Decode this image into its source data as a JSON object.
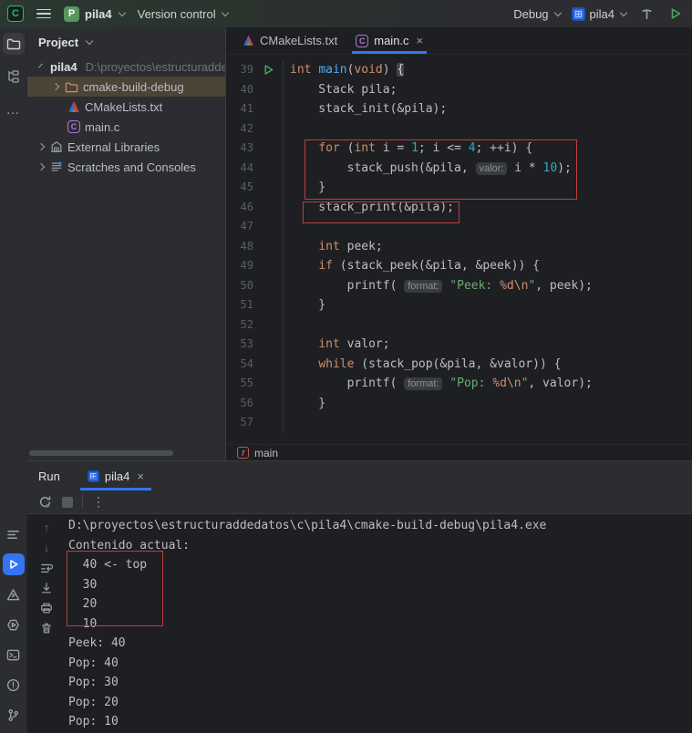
{
  "appearance": {
    "accent_blue": "#3574F0",
    "annotation_red": "#C43B3B",
    "keyword_orange": "#CF8E6D",
    "number_teal": "#2AACB8",
    "string_green": "#6AAB73",
    "run_green": "#4FA45F",
    "selected_row_brown": "#4B4336",
    "editor_bg": "#1E1F22",
    "panel_bg": "#2B2D30"
  },
  "icons": {
    "hamburger": "menu",
    "more_horizontal": "...",
    "more_vertical": "⋮",
    "close": "×",
    "arrow_up": "↑",
    "arrow_down": "↓"
  },
  "titlebar": {
    "project_name": "pila4",
    "version_control_label": "Version control",
    "debug_label": "Debug",
    "run_config_label": "pila4"
  },
  "project_panel": {
    "title": "Project",
    "items": [
      {
        "label": "pila4",
        "path": "D:\\proyectos\\estructuradded",
        "type": "project-root"
      },
      {
        "label": "cmake-build-debug",
        "type": "excluded-folder",
        "selected": true
      },
      {
        "label": "CMakeLists.txt",
        "type": "cmake-file"
      },
      {
        "label": "main.c",
        "type": "c-file"
      },
      {
        "label": "External Libraries",
        "type": "libraries"
      },
      {
        "label": "Scratches and Consoles",
        "type": "scratches"
      }
    ]
  },
  "editor": {
    "tabs": [
      {
        "label": "CMakeLists.txt",
        "active": false
      },
      {
        "label": "main.c",
        "active": true
      }
    ],
    "breadcrumb": "main",
    "lines": [
      {
        "num": 39,
        "gutter": "run",
        "tokens": [
          {
            "c": "k",
            "t": "int "
          },
          {
            "c": "f",
            "t": "main"
          },
          {
            "c": "d",
            "t": "("
          },
          {
            "c": "k",
            "t": "void"
          },
          {
            "c": "d",
            "t": ") "
          },
          {
            "c": "b",
            "t": "{"
          }
        ]
      },
      {
        "num": 40,
        "tokens": [
          {
            "c": "d",
            "t": "    Stack pila;"
          }
        ]
      },
      {
        "num": 41,
        "tokens": [
          {
            "c": "d",
            "t": "    stack_init(&pila);"
          }
        ]
      },
      {
        "num": 42,
        "tokens": []
      },
      {
        "num": 43,
        "tokens": [
          {
            "c": "d",
            "t": "    "
          },
          {
            "c": "k",
            "t": "for"
          },
          {
            "c": "d",
            "t": " ("
          },
          {
            "c": "k",
            "t": "int"
          },
          {
            "c": "d",
            "t": " i = "
          },
          {
            "c": "n",
            "t": "1"
          },
          {
            "c": "d",
            "t": "; i <= "
          },
          {
            "c": "n",
            "t": "4"
          },
          {
            "c": "d",
            "t": "; ++i) {"
          }
        ]
      },
      {
        "num": 44,
        "tokens": [
          {
            "c": "d",
            "t": "        stack_push(&pila, "
          },
          {
            "c": "h",
            "t": "valor:"
          },
          {
            "c": "d",
            "t": " i * "
          },
          {
            "c": "n",
            "t": "10"
          },
          {
            "c": "d",
            "t": ");"
          }
        ]
      },
      {
        "num": 45,
        "tokens": [
          {
            "c": "d",
            "t": "    }"
          }
        ]
      },
      {
        "num": 46,
        "tokens": [
          {
            "c": "d",
            "t": "    stack_print(&pila);"
          }
        ]
      },
      {
        "num": 47,
        "tokens": []
      },
      {
        "num": 48,
        "tokens": [
          {
            "c": "d",
            "t": "    "
          },
          {
            "c": "k",
            "t": "int"
          },
          {
            "c": "d",
            "t": " peek;"
          }
        ]
      },
      {
        "num": 49,
        "tokens": [
          {
            "c": "d",
            "t": "    "
          },
          {
            "c": "k",
            "t": "if"
          },
          {
            "c": "d",
            "t": " (stack_peek(&pila, &peek)) {"
          }
        ]
      },
      {
        "num": 50,
        "tokens": [
          {
            "c": "d",
            "t": "        printf( "
          },
          {
            "c": "h",
            "t": "format:"
          },
          {
            "c": "d",
            "t": " "
          },
          {
            "c": "s",
            "t": "\"Peek: "
          },
          {
            "c": "fs",
            "t": "%d\\n"
          },
          {
            "c": "s",
            "t": "\""
          },
          {
            "c": "d",
            "t": ", peek);"
          }
        ]
      },
      {
        "num": 51,
        "tokens": [
          {
            "c": "d",
            "t": "    }"
          }
        ]
      },
      {
        "num": 52,
        "tokens": []
      },
      {
        "num": 53,
        "tokens": [
          {
            "c": "d",
            "t": "    "
          },
          {
            "c": "k",
            "t": "int"
          },
          {
            "c": "d",
            "t": " valor;"
          }
        ]
      },
      {
        "num": 54,
        "tokens": [
          {
            "c": "d",
            "t": "    "
          },
          {
            "c": "k",
            "t": "while"
          },
          {
            "c": "d",
            "t": " (stack_pop(&pila, &valor)) {"
          }
        ]
      },
      {
        "num": 55,
        "tokens": [
          {
            "c": "d",
            "t": "        printf( "
          },
          {
            "c": "h",
            "t": "format:"
          },
          {
            "c": "d",
            "t": " "
          },
          {
            "c": "s",
            "t": "\"Pop: "
          },
          {
            "c": "fs",
            "t": "%d\\n"
          },
          {
            "c": "s",
            "t": "\""
          },
          {
            "c": "d",
            "t": ", valor);"
          }
        ]
      },
      {
        "num": 56,
        "tokens": [
          {
            "c": "d",
            "t": "    }"
          }
        ]
      },
      {
        "num": 57,
        "tokens": []
      }
    ]
  },
  "annotations": {
    "editor_boxes": [
      {
        "label": "for-loop lines 43-45"
      },
      {
        "label": "stack_print call line 46"
      }
    ],
    "console_box": {
      "label": "stack contents 40..10"
    }
  },
  "run_panel": {
    "title": "Run",
    "tab_label": "pila4",
    "console_lines": [
      "D:\\proyectos\\estructuraddedatos\\c\\pila4\\cmake-build-debug\\pila4.exe",
      "Contenido actual:",
      "  40 <- top",
      "  30",
      "  20",
      "  10",
      "Peek: 40",
      "Pop: 40",
      "Pop: 30",
      "Pop: 20",
      "Pop: 10"
    ]
  }
}
